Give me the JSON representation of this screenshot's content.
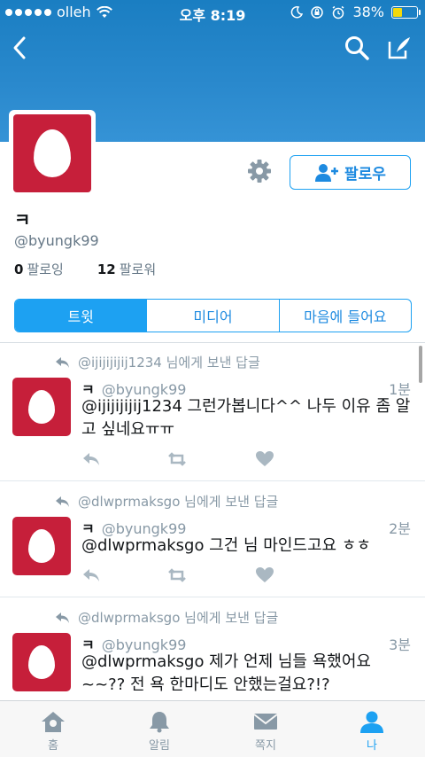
{
  "status_bar": {
    "carrier": "olleh",
    "time": "오후 8:19",
    "battery_percent": "38%",
    "battery_level": 0.38
  },
  "profile": {
    "display_name": "ㅋ",
    "handle": "@byungk99",
    "following_count": "0",
    "following_label": "팔로잉",
    "followers_count": "12",
    "followers_label": "팔로워",
    "follow_label": "팔로우"
  },
  "tabs": [
    {
      "label": "트윗",
      "active": true
    },
    {
      "label": "미디어",
      "active": false
    },
    {
      "label": "마음에 들어요",
      "active": false
    }
  ],
  "tweets": [
    {
      "reply_note": "@ijijijijij1234 님에게 보낸 답글",
      "name": "ㅋ",
      "handle": "@byungk99",
      "time": "1분",
      "text": "@ijijijijij1234 그런가봅니다^^ 나두 이유 좀 알고 싶네요ㅠㅠ"
    },
    {
      "reply_note": "@dlwprmaksgo 님에게 보낸 답글",
      "name": "ㅋ",
      "handle": "@byungk99",
      "time": "2분",
      "text": "@dlwprmaksgo 그건 님 마인드고요 ㅎㅎ"
    },
    {
      "reply_note": "@dlwprmaksgo 님에게 보낸 답글",
      "name": "ㅋ",
      "handle": "@byungk99",
      "time": "3분",
      "text": "@dlwprmaksgo 제가 언제 님들 욕했어요~~?? 전 욕 한마디도 안했는걸요?!?"
    }
  ],
  "tab_bar": [
    {
      "label": "홈",
      "icon": "home-icon"
    },
    {
      "label": "알림",
      "icon": "bell-icon"
    },
    {
      "label": "쪽지",
      "icon": "envelope-icon"
    },
    {
      "label": "나",
      "icon": "person-icon"
    }
  ],
  "colors": {
    "accent": "#1da1f2",
    "banner": "#2a89cd",
    "avatar": "#c61f3a"
  }
}
